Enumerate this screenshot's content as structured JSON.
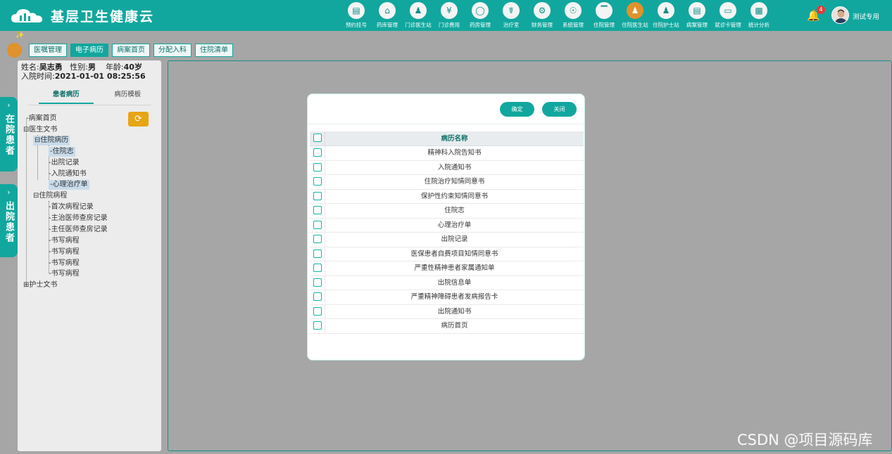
{
  "app": {
    "title": "基层卫生健康云"
  },
  "nav": [
    {
      "label": "预约挂号",
      "icon": "calendar-icon"
    },
    {
      "label": "药库管理",
      "icon": "warehouse-icon"
    },
    {
      "label": "门诊医生站",
      "icon": "doctor-icon"
    },
    {
      "label": "门诊费用",
      "icon": "yuan-icon"
    },
    {
      "label": "药房管理",
      "icon": "pill-icon"
    },
    {
      "label": "治疗室",
      "icon": "treatment-icon"
    },
    {
      "label": "财务管理",
      "icon": "gear-icon"
    },
    {
      "label": "系统管理",
      "icon": "settings-icon"
    },
    {
      "label": "住院管理",
      "icon": "bed-icon"
    },
    {
      "label": "住院医生站",
      "icon": "doctor-icon",
      "active": true
    },
    {
      "label": "住院护士站",
      "icon": "nurse-icon"
    },
    {
      "label": "病案管理",
      "icon": "document-icon"
    },
    {
      "label": "就诊卡管理",
      "icon": "card-icon"
    },
    {
      "label": "统计分析",
      "icon": "chart-icon"
    }
  ],
  "header": {
    "notifications": "4",
    "username": "测试专用"
  },
  "subtabs": [
    {
      "label": "医嘱管理"
    },
    {
      "label": "电子病历",
      "active": true
    },
    {
      "label": "病案首页"
    },
    {
      "label": "分配入科"
    },
    {
      "label": "住院清单"
    }
  ],
  "sidebar": {
    "inpatient": "在院患者",
    "discharged": "出院患者"
  },
  "patient": {
    "name_label": "姓名:",
    "name": "吴志勇",
    "gender_label": "性别:",
    "gender": "男",
    "age_label": "年龄:",
    "age": "40岁",
    "admit_label": "入院时间:",
    "admit_time": "2021-01-01 08:25:56"
  },
  "panel_tabs": {
    "records": "患者病历",
    "templates": "病历模板"
  },
  "tree": {
    "home": "病案首页",
    "doctor_docs": "医生文书",
    "inpatient_records": "住院病历",
    "ir_children": [
      "住院志",
      "出院记录",
      "入院通知书",
      "心理治疗单"
    ],
    "course": "住院病程",
    "course_children": [
      "首次病程记录",
      "主治医师查房记录",
      "主任医师查房记录",
      "书写病程",
      "书写病程",
      "书写病程",
      "书写病程"
    ],
    "nurse_docs": "护士文书"
  },
  "modal": {
    "confirm": "确定",
    "close": "关闭",
    "column_header": "病历名称",
    "rows": [
      "精神科入院告知书",
      "入院通知书",
      "住院治疗知情同意书",
      "保护性约束知情同意书",
      "住院志",
      "心理治疗单",
      "出院记录",
      "医保患者自费项目知情同意书",
      "严重性精神患者家属通知单",
      "出院信息单",
      "严重精神障碍患者发病报告卡",
      "出院通知书",
      "病历首页"
    ]
  },
  "watermark": "CSDN @项目源码库"
}
